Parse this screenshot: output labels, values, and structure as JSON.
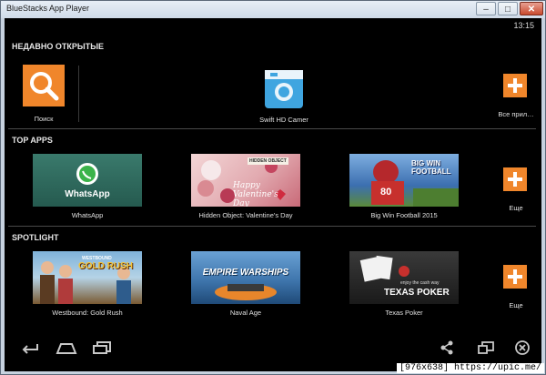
{
  "window": {
    "title": "BlueStacks App Player",
    "minimize": "–",
    "maximize": "□",
    "close": "✕"
  },
  "status": {
    "time": "13:15"
  },
  "recent": {
    "title": "НЕДАВНО ОТКРЫТЫЕ",
    "search_label": "Поиск",
    "app_label": "Swift HD Camer",
    "all_label": "Все прил…"
  },
  "top_apps": {
    "title": "TOP APPS",
    "more_label": "Еще",
    "items": [
      {
        "label": "WhatsApp",
        "banner": "WhatsApp"
      },
      {
        "label": "Hidden Object: Valentine's Day",
        "banner": "Happy Valentine's Day",
        "badge": "HIDDEN OBJECT"
      },
      {
        "label": "Big Win Football 2015",
        "banner": "BIG WIN FOOTBALL",
        "jersey": "80"
      }
    ]
  },
  "spotlight": {
    "title": "SPOTLIGHT",
    "more_label": "Еще",
    "items": [
      {
        "label": "Westbound: Gold Rush",
        "banner": "GOLD RUSH",
        "banner_top": "WESTBOUND"
      },
      {
        "label": "Naval Age",
        "banner": "EMPIRE WARSHIPS"
      },
      {
        "label": "Texas Poker",
        "banner": "TEXAS POKER",
        "tagline": "enjoy the cash way"
      }
    ]
  },
  "nav": {
    "back": "back-icon",
    "home": "home-icon",
    "recents": "recents-icon",
    "share": "share-icon",
    "screen": "screen-icon",
    "close": "close-circle-icon"
  },
  "watermark": "[976x638] https://upic.me/",
  "colors": {
    "accent": "#f0862b",
    "whatsapp": "#2f6b5e",
    "camera": "#3fa5e0"
  }
}
